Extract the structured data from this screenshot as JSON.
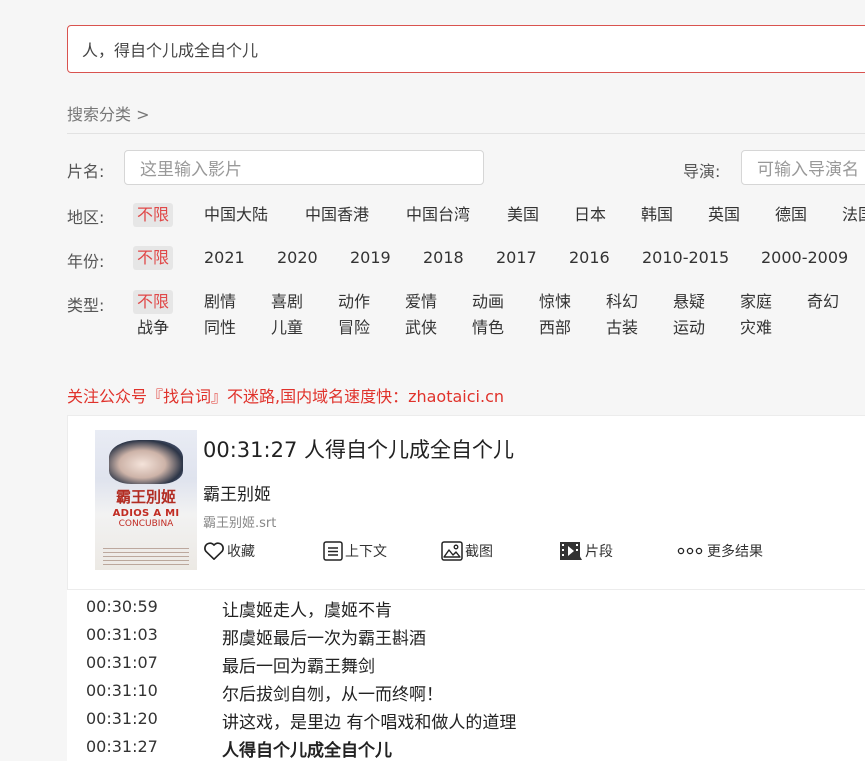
{
  "search": {
    "value": "人，得自个儿成全自个儿"
  },
  "breadcrumb": "搜索分类 >",
  "filters": {
    "title_label": "片名:",
    "title_placeholder": "这里输入影片",
    "director_label": "导演:",
    "director_placeholder": "可输入导演名",
    "region_label": "地区:",
    "regions": [
      "不限",
      "中国大陆",
      "中国香港",
      "中国台湾",
      "美国",
      "日本",
      "韩国",
      "英国",
      "德国",
      "法国"
    ],
    "year_label": "年份:",
    "years": [
      "不限",
      "2021",
      "2020",
      "2019",
      "2018",
      "2017",
      "2016",
      "2010-2015",
      "2000-2009"
    ],
    "genre_label": "类型:",
    "genres_row1": [
      "不限",
      "剧情",
      "喜剧",
      "动作",
      "爱情",
      "动画",
      "惊悚",
      "科幻",
      "悬疑",
      "家庭",
      "奇幻"
    ],
    "genres_row2": [
      "战争",
      "同性",
      "儿童",
      "冒险",
      "武侠",
      "情色",
      "西部",
      "古装",
      "运动",
      "灾难"
    ]
  },
  "notice": "关注公众号『找台词』不迷路,国内域名速度快：zhaotaici.cn",
  "result": {
    "title": "00:31:27 人得自个儿成全自个儿",
    "movie": "霸王别姬",
    "file": "霸王别姬.srt",
    "poster": {
      "calligraphy": "霸王別姬",
      "title_line1": "ADIOS A MI",
      "title_line2": "CONCUBINA"
    },
    "actions": {
      "favorite": "收藏",
      "context": "上下文",
      "screenshot": "截图",
      "clip": "片段",
      "more": "更多结果"
    }
  },
  "subtitles": [
    {
      "time": "00:30:59",
      "text": "让虞姬走人，虞姬不肯"
    },
    {
      "time": "00:31:03",
      "text": "那虞姬最后一次为霸王斟酒"
    },
    {
      "time": "00:31:07",
      "text": "最后一回为霸王舞剑"
    },
    {
      "time": "00:31:10",
      "text": "尔后拔剑自刎，从一而终啊！"
    },
    {
      "time": "00:31:20",
      "text": "讲这戏，是里边 有个唱戏和做人的道理"
    },
    {
      "time": "00:31:27",
      "text": "人得自个儿成全自个儿"
    }
  ],
  "colors": {
    "accent": "#e0322b",
    "active_filter": "#e04848"
  },
  "icons": [
    "heart-icon",
    "context-icon",
    "image-icon",
    "film-icon",
    "more-icon"
  ]
}
